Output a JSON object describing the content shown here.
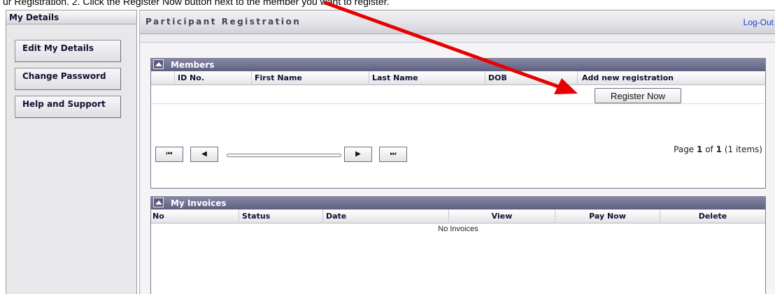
{
  "caption": "ur Registration. 2. Click the Register Now button next to the member you want to register.",
  "sidebar": {
    "header": "My Details",
    "items": [
      {
        "label": "Edit My Details"
      },
      {
        "label": "Change Password"
      },
      {
        "label": "Help and Support"
      }
    ]
  },
  "header": {
    "title": "Participant Registration",
    "logout": "Log-Out"
  },
  "members": {
    "title": "Members",
    "columns": [
      "ID No.",
      "First Name",
      "Last Name",
      "DOB",
      "Add new registration"
    ],
    "register_label": "Register Now",
    "pager": {
      "first": "⏮",
      "prev": "◀",
      "next": "▶",
      "last": "⏭",
      "page_word": "Page",
      "current": "1",
      "of_word": "of",
      "total": "1",
      "items": "(1 items)"
    }
  },
  "invoices": {
    "title": "My Invoices",
    "columns": [
      "No",
      "Status",
      "Date",
      "View",
      "Pay Now",
      "Delete"
    ],
    "empty_text": "No Invoices"
  },
  "colors": {
    "accent": "#e60000",
    "titlebar": "#6a6a8a",
    "link": "#1f3fbf"
  }
}
